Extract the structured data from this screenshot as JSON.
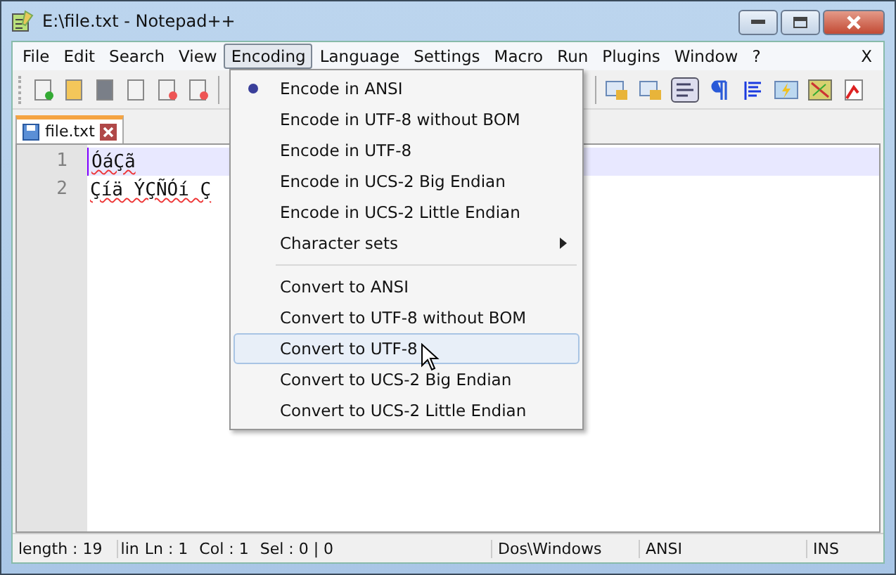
{
  "window": {
    "title": "E:\\file.txt - Notepad++"
  },
  "menubar": [
    {
      "label": "File",
      "selected": false
    },
    {
      "label": "Edit",
      "selected": false
    },
    {
      "label": "Search",
      "selected": false
    },
    {
      "label": "View",
      "selected": false
    },
    {
      "label": "Encoding",
      "selected": true
    },
    {
      "label": "Language",
      "selected": false
    },
    {
      "label": "Settings",
      "selected": false
    },
    {
      "label": "Macro",
      "selected": false
    },
    {
      "label": "Run",
      "selected": false
    },
    {
      "label": "Plugins",
      "selected": false
    },
    {
      "label": "Window",
      "selected": false
    },
    {
      "label": "?",
      "selected": false
    }
  ],
  "menubar_close": "X",
  "tabs": [
    {
      "label": "file.txt",
      "selected": true
    }
  ],
  "editor": {
    "lines": [
      {
        "number": "1",
        "text": "ÓáÇã",
        "current": true
      },
      {
        "number": "2",
        "text": "Çíä ÝÇÑÓí Ç",
        "current": false
      }
    ]
  },
  "encoding_menu": [
    {
      "kind": "item",
      "label": "Encode in ANSI",
      "checked": true,
      "highlighted": false
    },
    {
      "kind": "item",
      "label": "Encode in UTF-8 without BOM",
      "checked": false,
      "highlighted": false
    },
    {
      "kind": "item",
      "label": "Encode in UTF-8",
      "checked": false,
      "highlighted": false
    },
    {
      "kind": "item",
      "label": "Encode in UCS-2 Big Endian",
      "checked": false,
      "highlighted": false
    },
    {
      "kind": "item",
      "label": "Encode in UCS-2 Little Endian",
      "checked": false,
      "highlighted": false
    },
    {
      "kind": "submenu",
      "label": "Character sets",
      "checked": false,
      "highlighted": false
    },
    {
      "kind": "separator"
    },
    {
      "kind": "item",
      "label": "Convert to ANSI",
      "checked": false,
      "highlighted": false
    },
    {
      "kind": "item",
      "label": "Convert to UTF-8 without BOM",
      "checked": false,
      "highlighted": false
    },
    {
      "kind": "item",
      "label": "Convert to UTF-8",
      "checked": false,
      "highlighted": true
    },
    {
      "kind": "item",
      "label": "Convert to UCS-2 Big Endian",
      "checked": false,
      "highlighted": false
    },
    {
      "kind": "item",
      "label": "Convert to UCS-2 Little Endian",
      "checked": false,
      "highlighted": false
    }
  ],
  "status_bar": [
    "length : 19",
    "lin",
    "Ln : 1",
    "Col : 1",
    "Sel : 0 | 0",
    "Dos\\Windows",
    "ANSI",
    "INS"
  ]
}
